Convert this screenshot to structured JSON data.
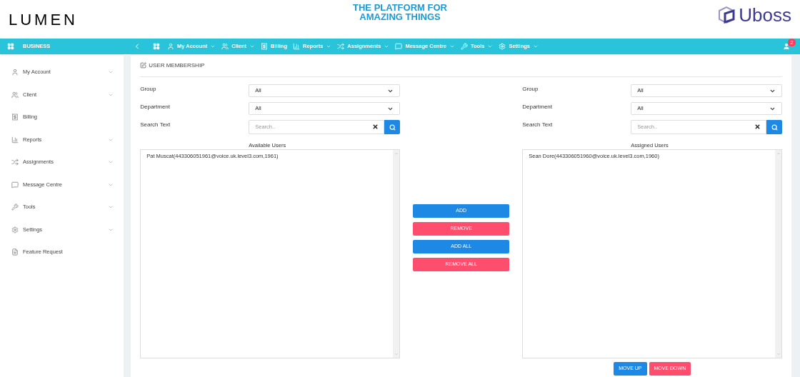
{
  "header": {
    "brand": "LUMEN",
    "tagline_lines": [
      "THE PLATFORM FOR",
      "AMAZING THINGS"
    ],
    "product": "Uboss"
  },
  "navbar": {
    "section": "BUSINESS",
    "items": [
      {
        "label": "My Account",
        "dropdown": true
      },
      {
        "label": "Client",
        "dropdown": true
      },
      {
        "label": "Billing",
        "dropdown": false
      },
      {
        "label": "Reports",
        "dropdown": true
      },
      {
        "label": "Assignments",
        "dropdown": true
      },
      {
        "label": "Message Centre",
        "dropdown": true
      },
      {
        "label": "Tools",
        "dropdown": true
      },
      {
        "label": "Settings",
        "dropdown": true
      }
    ],
    "notification_count": "2"
  },
  "sidebar": {
    "items": [
      {
        "label": "My Account",
        "dropdown": true
      },
      {
        "label": "Client",
        "dropdown": true
      },
      {
        "label": "Billing",
        "dropdown": false
      },
      {
        "label": "Reports",
        "dropdown": true
      },
      {
        "label": "Assignments",
        "dropdown": true
      },
      {
        "label": "Message Centre",
        "dropdown": true
      },
      {
        "label": "Tools",
        "dropdown": true
      },
      {
        "label": "Settings",
        "dropdown": true
      },
      {
        "label": "Feature Request",
        "dropdown": false
      }
    ]
  },
  "page_title": "USER MEMBERSHIP",
  "panels": [
    {
      "filters": [
        {
          "label": "Group",
          "value": "All"
        },
        {
          "label": "Department",
          "value": "All"
        }
      ],
      "search_label": "Search Text",
      "search_placeholder": "Search..",
      "list_title": "Available Users",
      "users": [
        "Pat Muscat(443306051961@voice.uk.level3.com,1961)"
      ]
    },
    {
      "filters": [
        {
          "label": "Group",
          "value": "All"
        },
        {
          "label": "Department",
          "value": "All"
        }
      ],
      "search_label": "Search Text",
      "search_placeholder": "Search..",
      "list_title": "Assigned Users",
      "users": [
        "Sean Dore(443306051960@voice.uk.level3.com,1960)"
      ]
    }
  ],
  "transfer_buttons": [
    {
      "label": "ADD",
      "kind": "primary"
    },
    {
      "label": "REMOVE",
      "kind": "danger"
    },
    {
      "label": "ADD ALL",
      "kind": "primary"
    },
    {
      "label": "REMOVE ALL",
      "kind": "danger"
    }
  ],
  "order_buttons": [
    {
      "label": "MOVE UP",
      "kind": "primary"
    },
    {
      "label": "MOVE DOWN",
      "kind": "danger"
    }
  ]
}
